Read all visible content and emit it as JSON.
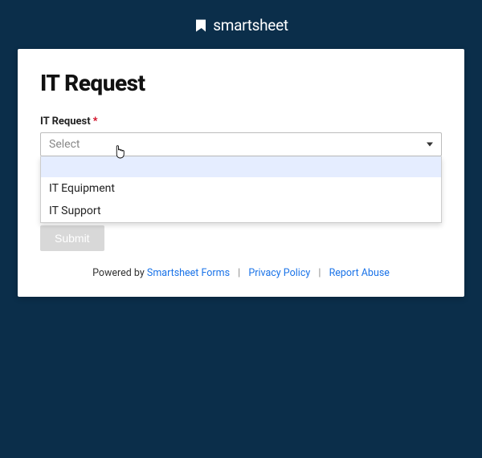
{
  "header": {
    "brand_name": "smartsheet"
  },
  "form": {
    "title": "IT Request",
    "field": {
      "label": "IT Request",
      "required_marker": "*",
      "placeholder": "Select",
      "options": [
        {
          "label": "",
          "highlighted": true
        },
        {
          "label": "IT Equipment",
          "highlighted": false
        },
        {
          "label": "IT Support",
          "highlighted": false
        }
      ]
    },
    "submit_label": "Submit"
  },
  "footer": {
    "prefix": "Powered by ",
    "forms_link": "Smartsheet Forms",
    "privacy_link": "Privacy Policy",
    "report_abuse_link": "Report Abuse",
    "separator": "|"
  }
}
